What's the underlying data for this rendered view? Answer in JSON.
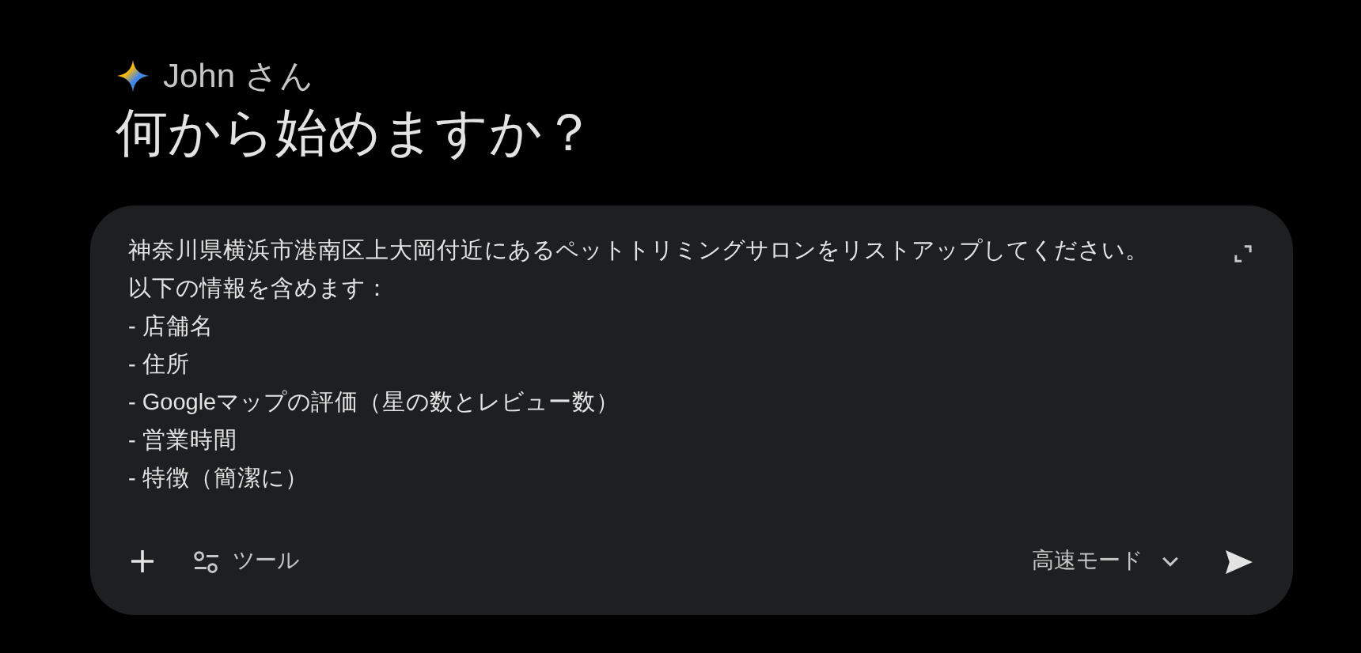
{
  "greeting": {
    "name": "John さん",
    "heading": "何から始めますか？"
  },
  "prompt": {
    "lines": [
      "神奈川県横浜市港南区上大岡付近にあるペットトリミングサロンをリストアップしてください。",
      "以下の情報を含めます：",
      "- 店舗名",
      "- 住所",
      "- Googleマップの評価（星の数とレビュー数）",
      "- 営業時間",
      "- 特徴（簡潔に）"
    ]
  },
  "toolbar": {
    "tools_label": "ツール",
    "mode_label": "高速モード"
  }
}
